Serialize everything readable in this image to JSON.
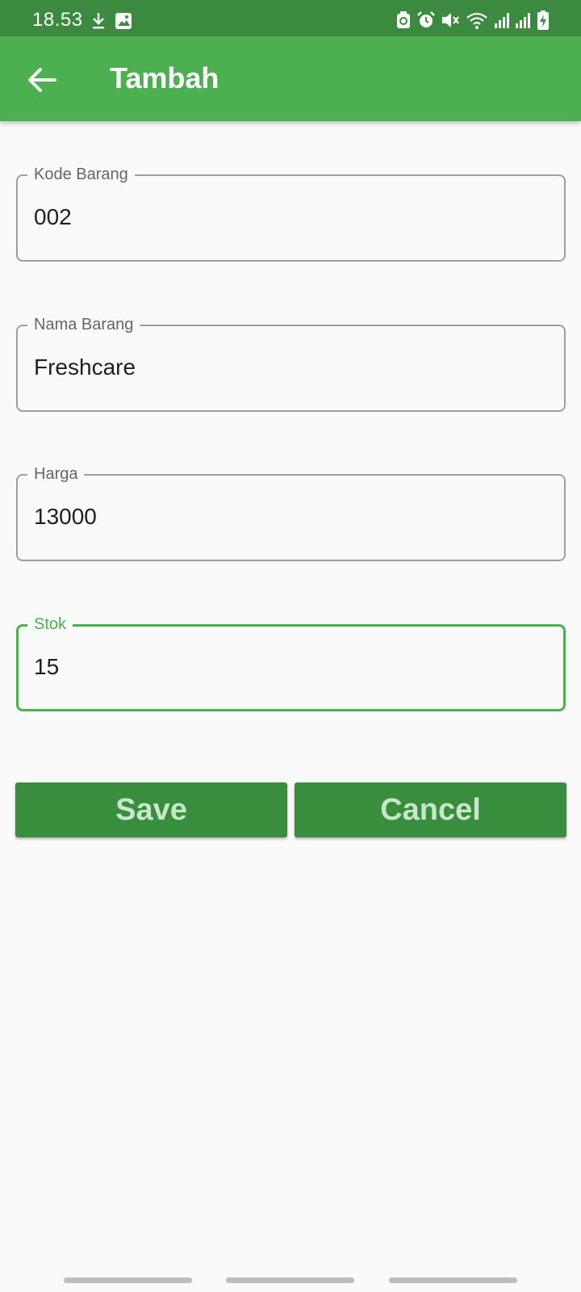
{
  "status_bar": {
    "time": "18.53",
    "left_icons": [
      "download-icon",
      "image-icon"
    ],
    "right_icons": [
      "backup-icon",
      "alarm-icon",
      "mute-icon",
      "wifi-icon",
      "signal-icon",
      "signal-icon",
      "battery-charging-icon"
    ]
  },
  "app_bar": {
    "back_icon": "arrow-back-icon",
    "title": "Tambah"
  },
  "form": {
    "kode_barang": {
      "label": "Kode Barang",
      "value": "002"
    },
    "nama_barang": {
      "label": "Nama Barang",
      "value": "Freshcare"
    },
    "harga": {
      "label": "Harga",
      "value": "13000"
    },
    "stok": {
      "label": "Stok",
      "value": "15",
      "focused": true
    }
  },
  "buttons": {
    "save": "Save",
    "cancel": "Cancel"
  },
  "colors": {
    "status_bar": "#3b8a40",
    "app_bar": "#4caf50",
    "button": "#388e3c",
    "button_text": "#c8e6c9",
    "focus": "#4caf50",
    "background": "#fafafa"
  }
}
